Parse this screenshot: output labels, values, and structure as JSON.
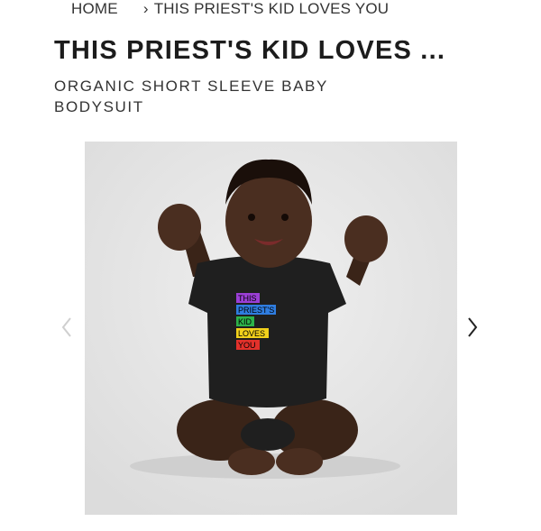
{
  "breadcrumb": {
    "home": "HOME",
    "current": "THIS PRIEST'S KID LOVES YOU"
  },
  "product": {
    "title": "THIS PRIEST'S KID LOVES ...",
    "subtitle": "ORGANIC SHORT SLEEVE BABY BODYSUIT"
  },
  "image": {
    "shirt_text": [
      "THIS",
      "PRIEST'S",
      "KID",
      "LOVES",
      "YOU"
    ],
    "shirt_colors": [
      "#9b3fd6",
      "#2f7de0",
      "#2db34a",
      "#f2d11b",
      "#e3312b"
    ],
    "background_color": "#e8e8e8"
  },
  "icons": {
    "prev": "chevron-left-icon",
    "next": "chevron-right-icon"
  }
}
